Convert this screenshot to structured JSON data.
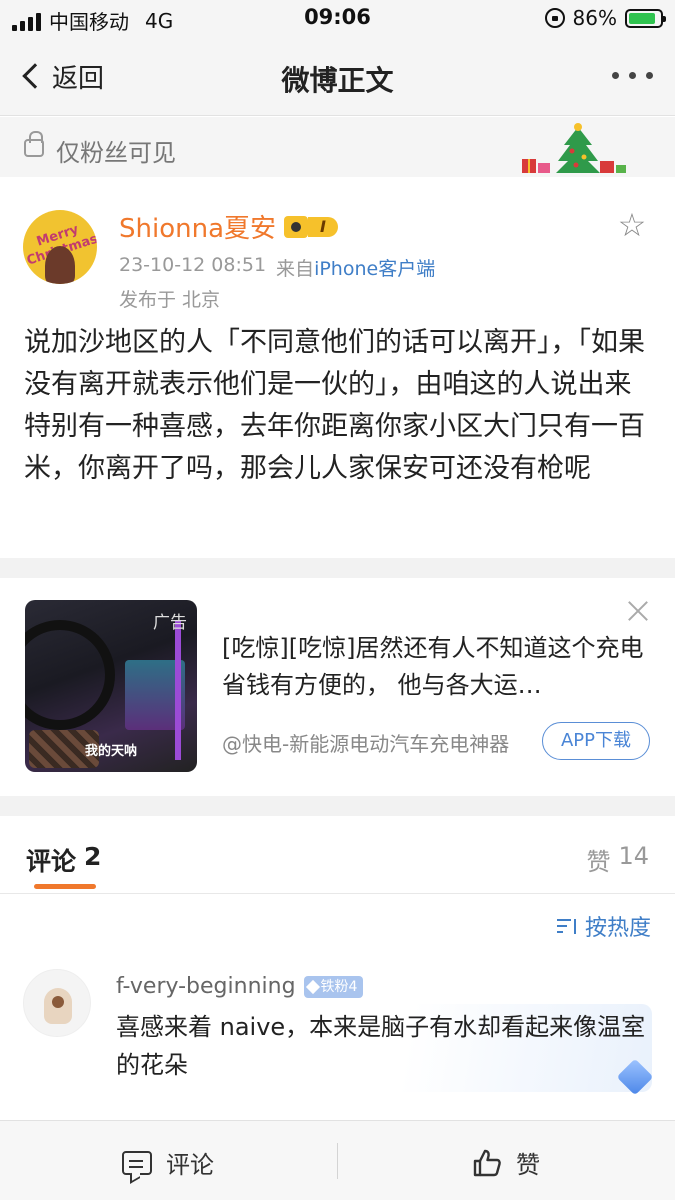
{
  "status_bar": {
    "carrier": "中国移动",
    "network": "4G",
    "time": "09:06",
    "battery_percent": "86%"
  },
  "nav": {
    "back_label": "返回",
    "title": "微博正文"
  },
  "visibility": {
    "label": "仅粉丝可见"
  },
  "post": {
    "avatar_text": "Merry Christmas",
    "username": "Shionna夏安",
    "vip_level": "I",
    "timestamp": "23-10-12 08:51",
    "source_prefix": "来自",
    "source": "iPhone客户端",
    "location": "发布于 北京",
    "text": "说加沙地区的人「不同意他们的话可以离开」，「如果没有离开就表示他们是一伙的」，由咱这的人说出来特别有一种喜感，去年你距离你家小区大门只有一百米，你离开了吗，那会儿人家保安可还没有枪呢"
  },
  "ad": {
    "badge": "广告",
    "image_caption": "我的天呐",
    "text": "[吃惊][吃惊]居然还有人不知道这个充电省钱有方便的， 他与各大运…",
    "advertiser": "@快电-新能源电动汽车充电神器",
    "button_label": "APP下载"
  },
  "comments": {
    "tab_label": "评论",
    "tab_count": "2",
    "likes_label": "赞",
    "likes_count": "14",
    "sort_label": "按热度",
    "items": [
      {
        "user": "f-very-beginning",
        "badge": "铁粉4",
        "text": "喜感来着 naive，本来是脑子有水却看起来像温室的花朵"
      }
    ]
  },
  "toolbar": {
    "comment_label": "评论",
    "like_label": "赞"
  },
  "colors": {
    "accent_orange": "#f0782c",
    "link_blue": "#3f7ec7",
    "battery_green": "#2fc34f"
  }
}
